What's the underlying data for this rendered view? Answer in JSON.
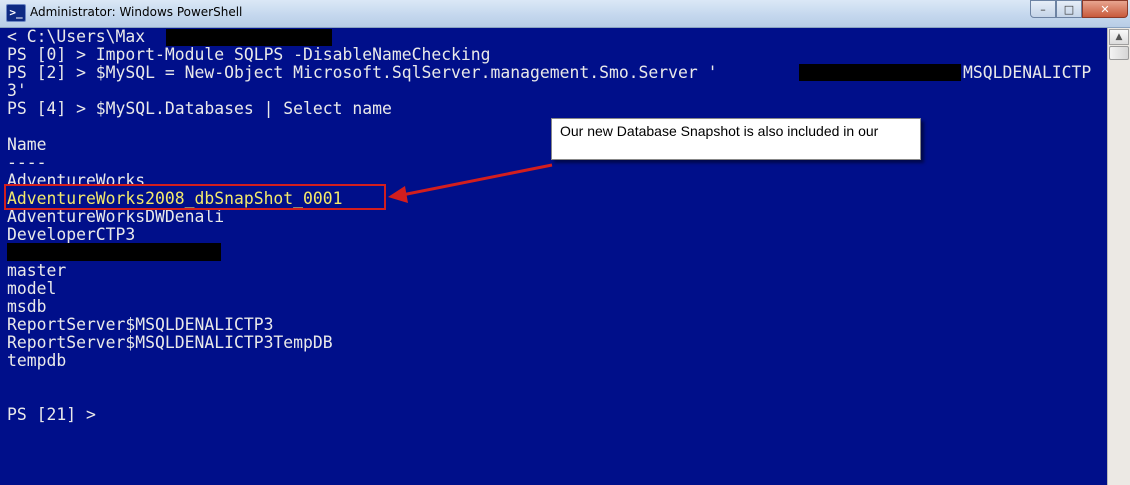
{
  "window": {
    "title": "Administrator: Windows PowerShell",
    "app_icon": "powershell-icon",
    "buttons": {
      "minimize": "–",
      "maximize": "□",
      "close": "✕"
    }
  },
  "console": {
    "lines": [
      "< C:\\Users\\Max",
      "PS [0] > Import-Module SQLPS -DisableNameChecking",
      "PS [2] > $MySQL = New-Object Microsoft.SqlServer.management.Smo.Server '",
      "MSQLDENALICTP",
      "3'",
      "PS [4] > $MySQL.Databases | Select name",
      "Name",
      "----",
      "AdventureWorks",
      "AdventureWorks2008_dbSnapShot_0001",
      "AdventureWorksDWDenali",
      "DeveloperCTP3",
      "master",
      "model",
      "msdb",
      "ReportServer$MSQLDENALICTP3",
      "ReportServer$MSQLDENALICTP3TempDB",
      "tempdb",
      "PS [21] >"
    ]
  },
  "callout": {
    "text": "Our new Database Snapshot is also included in our"
  },
  "colors": {
    "console_bg": "#000f8a",
    "console_text": "#e9e9e9",
    "highlight_text": "#f3e96a",
    "annotation_red": "#d21e1e"
  }
}
